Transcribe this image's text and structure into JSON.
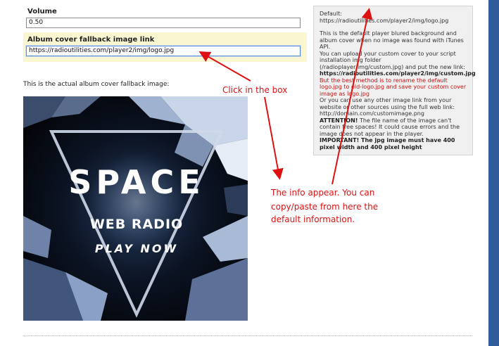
{
  "form": {
    "volume": {
      "label": "Volume",
      "value": "0.50"
    },
    "fallback": {
      "label": "Album cover fallback image link",
      "value": "https://radioutilities.com/player2/img/logo.jpg"
    },
    "actual_caption": "This is the actual album cover fallback image:"
  },
  "album": {
    "title": "SPACE",
    "subtitle": "WEB RADIO",
    "cta": "PLAY NOW"
  },
  "info": {
    "default_line": "Default: https://radioutilities.com/player2/img/logo.jpg",
    "p1": "This is the default player blured background and album cover when no image was found with iTunes API.",
    "p2": "You can upload your custom cover to your script installation img folder (/radioplayer/img/custom.jpg) and put the new link:",
    "link_bold": "https://radioutilities.com/player2/img/custom.jpg",
    "red": "But the best method is to rename the default logo.jpg to old-logo.jpg and save your custom cover image as logo.jpg",
    "p3": "Or you can use any other image link from your website or other sources using the full web link: http://domain.com/customimage.png",
    "attention_label": "ATTENTION!",
    "attention_text": " The file name of the image can't contain free spaces! It could cause errors and the image does not appear in the player.",
    "important": "IMPORTANT! The jpg image must have 400 pixel width and 400 pixel height"
  },
  "annotations": {
    "click": "Click in the box",
    "info_line1": "The info appear. You can",
    "info_line2": "copy/paste from here the",
    "info_line3": "default information."
  },
  "colors": {
    "annotation": "#dd1111",
    "highlight": "#fbf6d2",
    "side_bar": "#2f5d9b"
  }
}
